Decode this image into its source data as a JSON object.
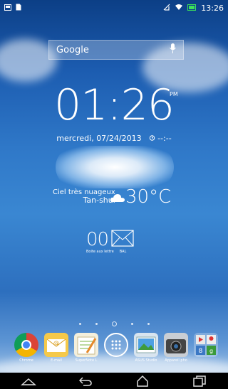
{
  "status": {
    "time": "13:26"
  },
  "search": {
    "label": "Google"
  },
  "clock": {
    "time": "01:26",
    "ampm": "PM",
    "date": "mercredi, 07/24/2013",
    "alarm": "--:--"
  },
  "weather": {
    "condition": "Ciel très nuageux",
    "city": "Tan-shui",
    "temperature": "30°C"
  },
  "mail": {
    "count": "00",
    "label_left": "Boite aux lettre",
    "label_right": "BAL"
  },
  "dock": {
    "apps": [
      {
        "label": "Chrome"
      },
      {
        "label": "E-mail"
      },
      {
        "label": "SuperNote L"
      },
      {
        "label": ""
      },
      {
        "label": "ASUS Studio"
      },
      {
        "label": "Appareil pho"
      },
      {
        "label": ""
      }
    ]
  }
}
